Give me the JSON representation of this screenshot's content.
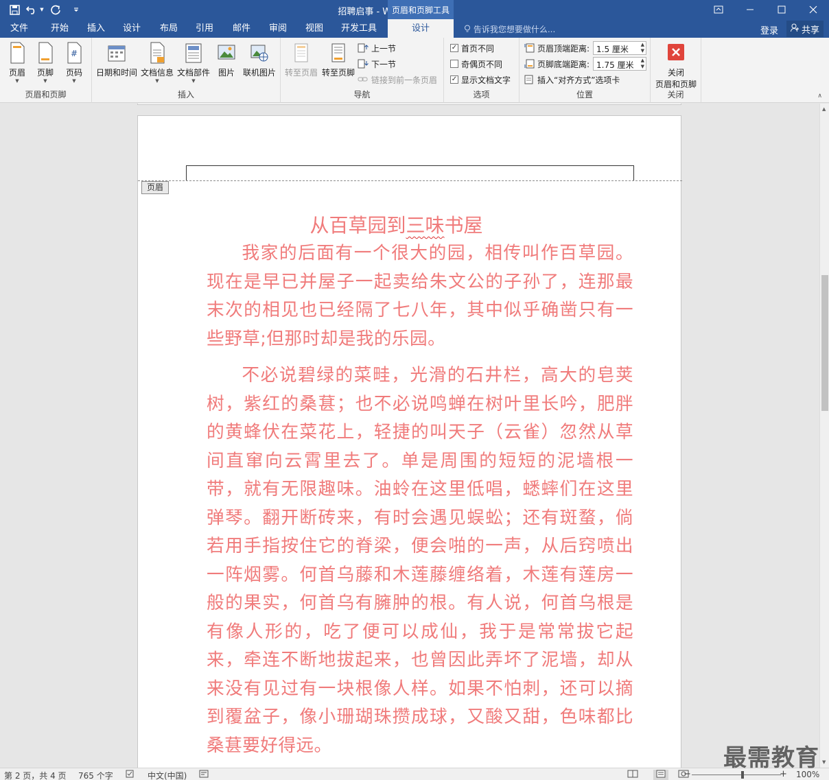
{
  "window": {
    "title": "招聘启事 - Word",
    "context_tab_group": "页眉和页脚工具",
    "controls": [
      "restore-ribbon-icon",
      "minimize-icon",
      "maximize-icon",
      "close-icon"
    ]
  },
  "qat": [
    "save-icon",
    "undo-icon",
    "redo-icon",
    "customize-icon"
  ],
  "tabs": [
    "文件",
    "开始",
    "插入",
    "设计",
    "布局",
    "引用",
    "邮件",
    "审阅",
    "视图",
    "开发工具",
    "设计"
  ],
  "tell_me": "告诉我您想要做什么...",
  "account": {
    "login": "登录",
    "share": "共享"
  },
  "ribbon": {
    "group1": {
      "label": "页眉和页脚",
      "header": "页眉",
      "footer": "页脚",
      "page_number": "页码"
    },
    "group2": {
      "label": "插入",
      "datetime": "日期和时间",
      "docinfo": "文档信息",
      "docparts": "文档部件",
      "picture": "图片",
      "online_picture": "联机图片"
    },
    "group3": {
      "label": "导航",
      "goto_header": "转至页眉",
      "goto_footer": "转至页脚",
      "prev_section": "上一节",
      "next_section": "下一节",
      "link_previous": "链接到前一条页眉"
    },
    "group4": {
      "label": "选项",
      "diff_first": "首页不同",
      "diff_odd_even": "奇偶页不同",
      "show_doc_text": "显示文档文字",
      "diff_first_checked": true,
      "diff_odd_even_checked": false,
      "show_doc_text_checked": true
    },
    "group5": {
      "label": "位置",
      "header_top_label": "页眉顶端距离:",
      "header_top_value": "1.5 厘米",
      "footer_bottom_label": "页脚底端距离:",
      "footer_bottom_value": "1.75 厘米",
      "insert_align_tab": "插入“对齐方式”选项卡"
    },
    "group6": {
      "label": "关闭",
      "close_line1": "关闭",
      "close_line2": "页眉和页脚"
    }
  },
  "document": {
    "header_tag": "页眉",
    "heading_pre": "从百草园到",
    "heading_wavy": "三味",
    "heading_post": "书屋",
    "paragraph1": "我家的后面有一个很大的园，相传叫作百草园。现在是早已并屋子一起卖给朱文公的子孙了，连那最末次的相见也已经隔了七八年，其中似乎确凿只有一些野草;但那时却是我的乐园。",
    "paragraph2": "不必说碧绿的菜畦，光滑的石井栏，高大的皂荚树，紫红的桑葚；也不必说鸣蝉在树叶里长吟，肥胖的黄蜂伏在菜花上，轻捷的叫天子（云雀）忽然从草间直窜向云霄里去了。单是周围的短短的泥墙根一带，就有无限趣味。油蛉在这里低唱，蟋蟀们在这里弹琴。翻开断砖来，有时会遇见蜈蚣；还有斑蝥，倘若用手指按住它的脊梁，便会啪的一声，从后窍喷出一阵烟雾。何首乌藤和木莲藤缠络着，木莲有莲房一般的果实，何首乌有臃肿的根。有人说，何首乌根是有像人形的，吃了便可以成仙，我于是常常拔它起来，牵连不断地拔起来，也曾因此弄坏了泥墙，却从来没有见过有一块根像人样。如果不怕刺，还可以摘到覆盆子，像小珊瑚珠攒成球，又酸又甜，色味都比桑葚要好得远。",
    "text_color": "#f07b7b"
  },
  "status": {
    "page": "第 2 页，共 4 页",
    "words": "765 个字",
    "language": "中文(中国)",
    "zoom": "100%",
    "zoom_minus": "−",
    "zoom_plus": "+"
  },
  "watermark": "最需教育",
  "colors": {
    "brand": "#2b579a",
    "ribbon_bg": "#f3f3f3",
    "close_red": "#e0443b"
  }
}
